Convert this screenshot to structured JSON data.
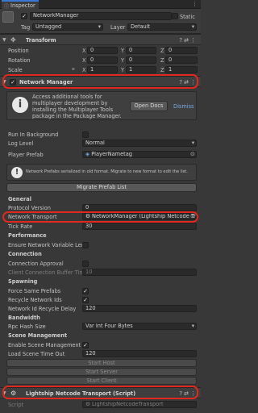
{
  "tab": {
    "label": "Inspector"
  },
  "object": {
    "name": "NetworkManager",
    "static": "Static",
    "tag_label": "Tag",
    "tag_value": "Untagged",
    "layer_label": "Layer",
    "layer_value": "Default"
  },
  "transform": {
    "title": "Transform",
    "rows": [
      {
        "label": "Position",
        "x": "0",
        "y": "0",
        "z": "0"
      },
      {
        "label": "Rotation",
        "x": "0",
        "y": "0",
        "z": "0"
      },
      {
        "label": "Scale",
        "x": "1",
        "y": "1",
        "z": "1"
      }
    ],
    "axes": {
      "x": "X",
      "y": "Y",
      "z": "Z"
    }
  },
  "network_manager": {
    "title": "Network Manager",
    "info": {
      "line1": "Access additional tools for",
      "line2": "multiplayer development by",
      "line3": "installing the Multiplayer Tools",
      "line4": "package in the Package Manager.",
      "open_docs": "Open Docs",
      "dismiss": "Dismiss"
    },
    "run_in_background": "Run In Background",
    "log_level": "Log Level",
    "log_level_value": "Normal",
    "player_prefab": "Player Prefab",
    "player_prefab_value": "PlayerNametag",
    "warning": "Network Prefabs serialized in old format. Migrate to new format to edit the list.",
    "migrate": "Migrate Prefab List",
    "general": "General",
    "protocol_version": "Protocol Version",
    "protocol_version_value": "0",
    "network_transport": "Network Transport",
    "network_transport_value": "NetworkManager (Lightship Netcode Tra",
    "tick_rate": "Tick Rate",
    "tick_rate_value": "30",
    "performance": "Performance",
    "ensure_net_var": "Ensure Network Variable Ler",
    "connection": "Connection",
    "connection_approval": "Connection Approval",
    "client_conn_buffer": "Client Connection Buffer Tin",
    "client_conn_buffer_value": "10",
    "spawning": "Spawning",
    "force_same_prefabs": "Force Same Prefabs",
    "recycle_ids": "Recycle Network Ids",
    "recycle_delay": "Network Id Recycle Delay",
    "recycle_delay_value": "120",
    "bandwidth": "Bandwidth",
    "rpc_hash": "Rpc Hash Size",
    "rpc_hash_value": "Var Int Four Bytes",
    "scene_management": "Scene Management",
    "enable_scene_mgmt": "Enable Scene Management",
    "load_timeout": "Load Scene Time Out",
    "load_timeout_value": "120",
    "start_host": "Start Host",
    "start_server": "Start Server",
    "start_client": "Start Client"
  },
  "lightship": {
    "title": "Lightship Netcode Transport (Script)",
    "script_label": "Script",
    "script_value": "LightshipNetcodeTransport"
  },
  "colors": {
    "background": "#383838",
    "highlight": "#e0281f",
    "field": "#2a2a2a"
  }
}
